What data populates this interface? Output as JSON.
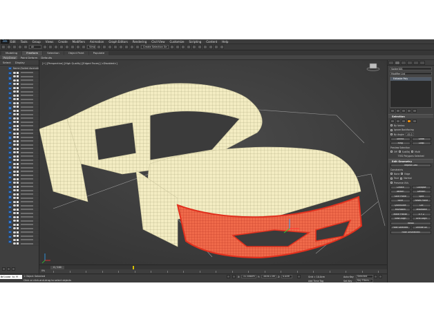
{
  "app": {
    "logo": "3ds"
  },
  "menu": [
    "Edit",
    "Tools",
    "Group",
    "Views",
    "Create",
    "Modifiers",
    "Animation",
    "Graph Editors",
    "Rendering",
    "Civil View",
    "Customize",
    "Scripting",
    "Content",
    "Help"
  ],
  "toolbar": {
    "filter_dropdown": "All",
    "view_dropdown": "View",
    "selection_set": "Create Selection Se"
  },
  "ribbon": {
    "tabs": [
      "Modeling",
      "Freeform",
      "Selection",
      "Object Paint",
      "Populate"
    ],
    "active_tab": "Freeform",
    "sub_tabs": [
      "PolyDraw",
      "Paint Deform",
      "Defaults"
    ]
  },
  "scene_explorer": {
    "tabs": [
      "Select",
      "Display"
    ],
    "column_header": "Name (Sorted Ascending)",
    "row_count": 46
  },
  "viewport": {
    "label": "[+] [Perspective] [High Quality] [Edged Faces] [<Disabled>]"
  },
  "command_panel": {
    "object_name": "Spider001",
    "modifier_list": "Modifier List",
    "stack_item": "Editable Poly",
    "selection": {
      "title": "Selection",
      "by_vertex": "By Vertex",
      "ignore_backfacing": "Ignore Backfacing",
      "by_angle": "By Angle:",
      "by_angle_value": "45.0",
      "shrink": "Shrink",
      "grow": "Grow",
      "ring": "Ring",
      "loop": "Loop",
      "preview_selection": "Preview Selection",
      "preview_options": [
        "Off",
        "SubObj",
        "Multi"
      ],
      "info": "7352 Polygons Selected"
    },
    "edit_geometry": {
      "title": "Edit Geometry",
      "repeat_last": "Repeat Last",
      "constraints": "Constraints",
      "constraint_options": [
        "None",
        "Edge",
        "Face",
        "Normal"
      ],
      "preserve_uvs": "Preserve UVs",
      "buttons": [
        [
          "Create",
          "Collapse"
        ],
        [
          "Attach",
          "Detach"
        ],
        [
          "Slice Plane",
          "Split"
        ],
        [
          "Slice",
          "Reset Plane"
        ],
        [
          "QuickSlice",
          "Cut"
        ],
        [
          "MSmooth",
          "Tessellate"
        ],
        [
          "Make Planar",
          "X Y Z"
        ],
        [
          "View Align",
          "Grid Align"
        ],
        [
          "Relax"
        ],
        [
          "Hide Selected",
          "Unhide All"
        ],
        [
          "Hide Unselected"
        ]
      ]
    }
  },
  "timeline": {
    "counter": "0 / 100",
    "start": "0%"
  },
  "status": {
    "maxscript": "Welcome to M",
    "line1": "1 Object Selected",
    "line2": "Click or click-and-drag to select objects",
    "x_label": "X:",
    "x_value": "-51.586cm",
    "y_label": "Y:",
    "y_value": "-5856.15m",
    "z_label": "Z:",
    "z_value": "0.0cm",
    "grid": "Grid = 10.0cm",
    "add_time_tag": "Add Time Tag",
    "auto_key": "Auto Key",
    "set_key": "Set Key",
    "selected": "Selected",
    "key_filters": "Key Filters..."
  },
  "colors": {
    "accent": "#e28a12",
    "selection_red": "#e0301e",
    "mesh": "#f3ecc2",
    "viewport_bg": "#3c3c3c"
  }
}
